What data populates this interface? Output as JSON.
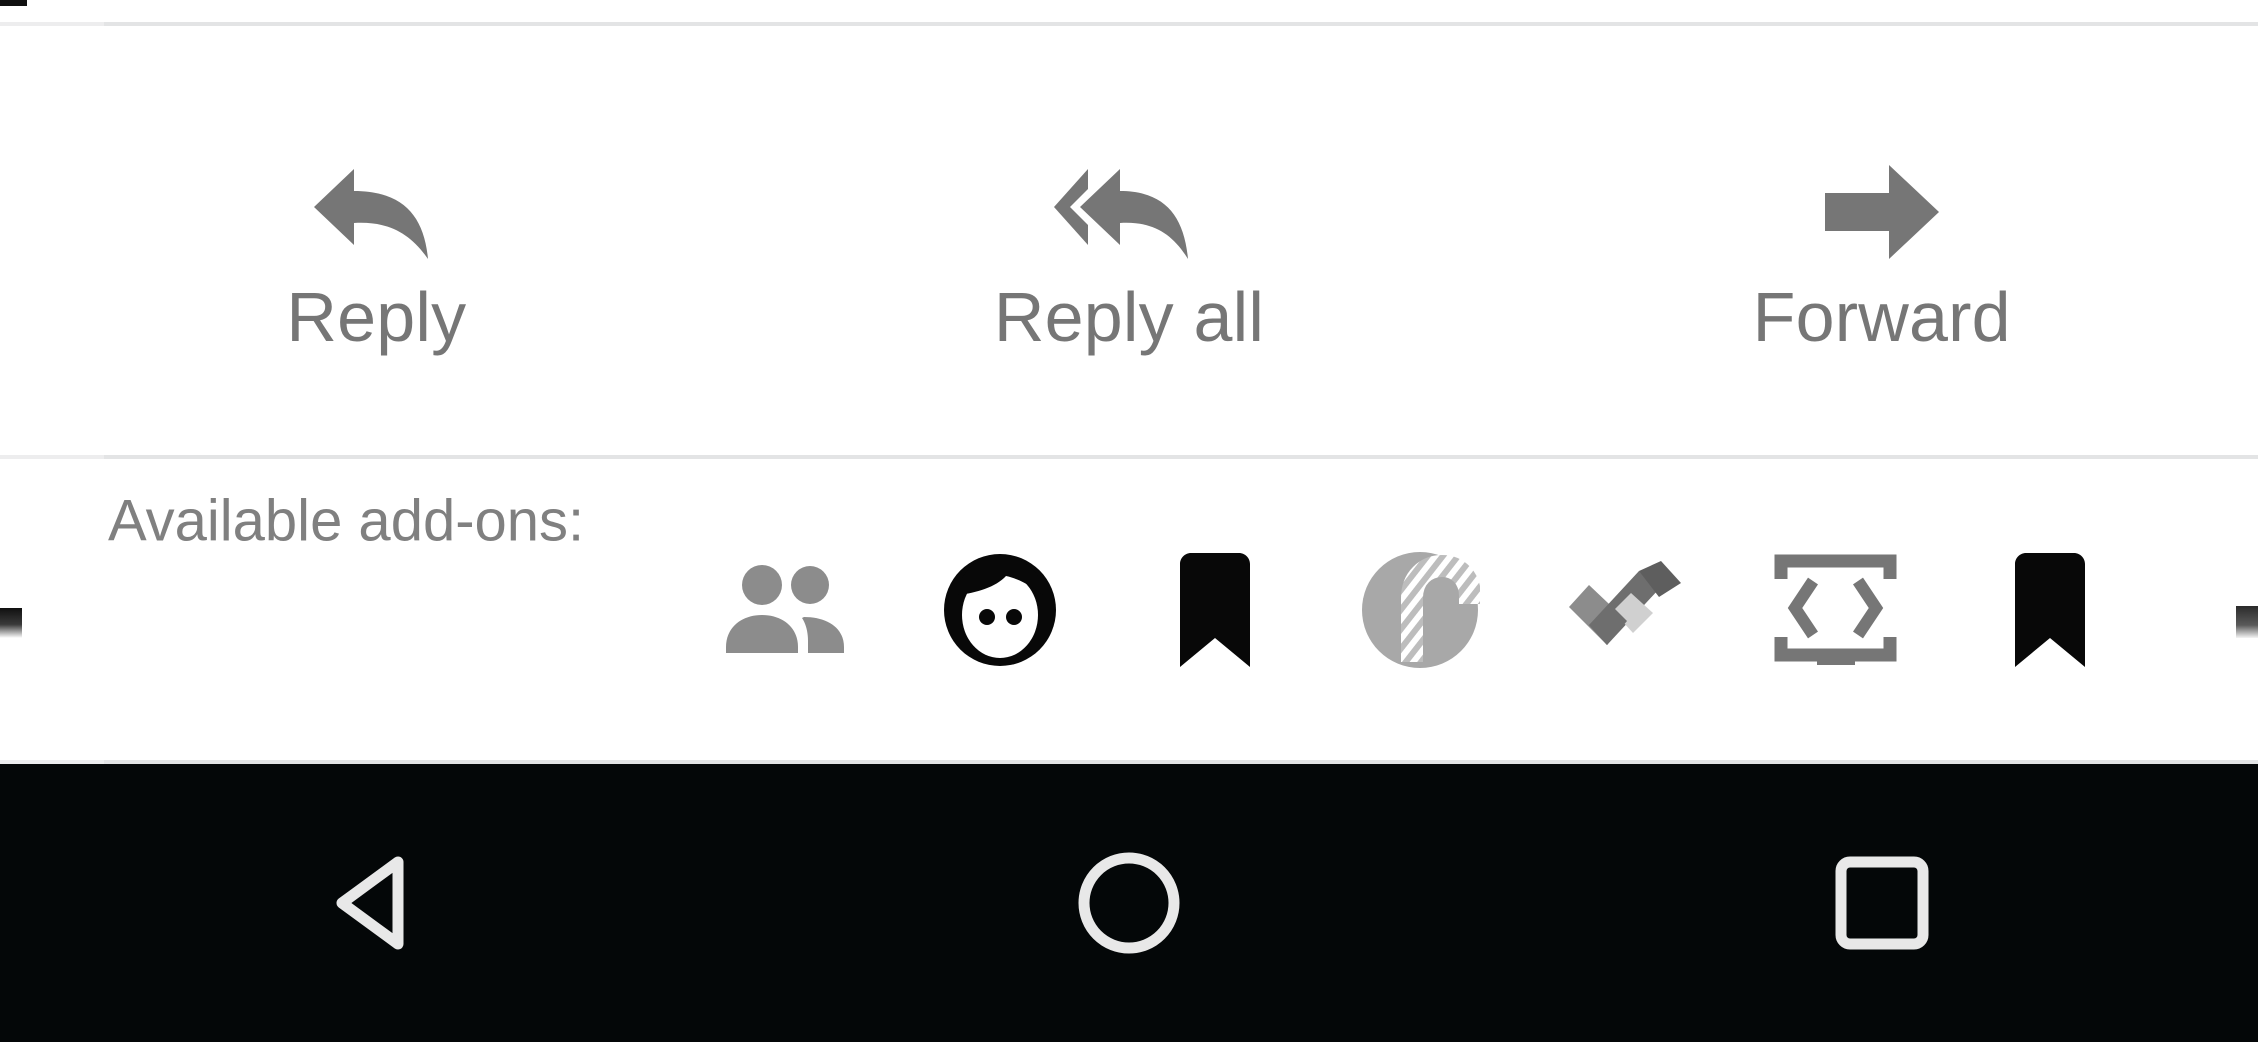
{
  "app": {
    "platform": "android",
    "screen": "email-message-actions"
  },
  "colors": {
    "icon_gray": "#767676",
    "text_gray": "#767676",
    "label_gray": "#808080",
    "divider": "#e3e4e5",
    "nav_bar_background": "#040708",
    "nav_icon": "#e8e8e8",
    "addon_black": "#080808",
    "addon_gray": "#8c8c8c",
    "page_background": "#ffffff"
  },
  "reply_bar": {
    "actions": [
      {
        "label": "Reply",
        "icon": "reply-arrow-icon"
      },
      {
        "label": "Reply all",
        "icon": "reply-all-arrow-icon"
      },
      {
        "label": "Forward",
        "icon": "forward-arrow-icon"
      }
    ]
  },
  "addons": {
    "label": "Available add-ons:",
    "items": [
      {
        "icon": "people-contacts-icon",
        "name": "contacts-addon"
      },
      {
        "icon": "face-avatar-icon",
        "name": "avatar-addon"
      },
      {
        "icon": "bookmark-icon",
        "name": "bookmark-addon"
      },
      {
        "icon": "candy-cane-circle-icon",
        "name": "candy-cane-addon"
      },
      {
        "icon": "checkmark-tasks-icon",
        "name": "tasks-addon"
      },
      {
        "icon": "code-brackets-icon",
        "name": "code-addon"
      },
      {
        "icon": "bookmark-icon",
        "name": "bookmark-addon-2"
      }
    ]
  },
  "nav_bar": {
    "buttons": [
      {
        "label": "Back",
        "icon": "back-triangle-icon"
      },
      {
        "label": "Home",
        "icon": "home-circle-icon"
      },
      {
        "label": "Recents",
        "icon": "recents-square-icon"
      }
    ]
  }
}
